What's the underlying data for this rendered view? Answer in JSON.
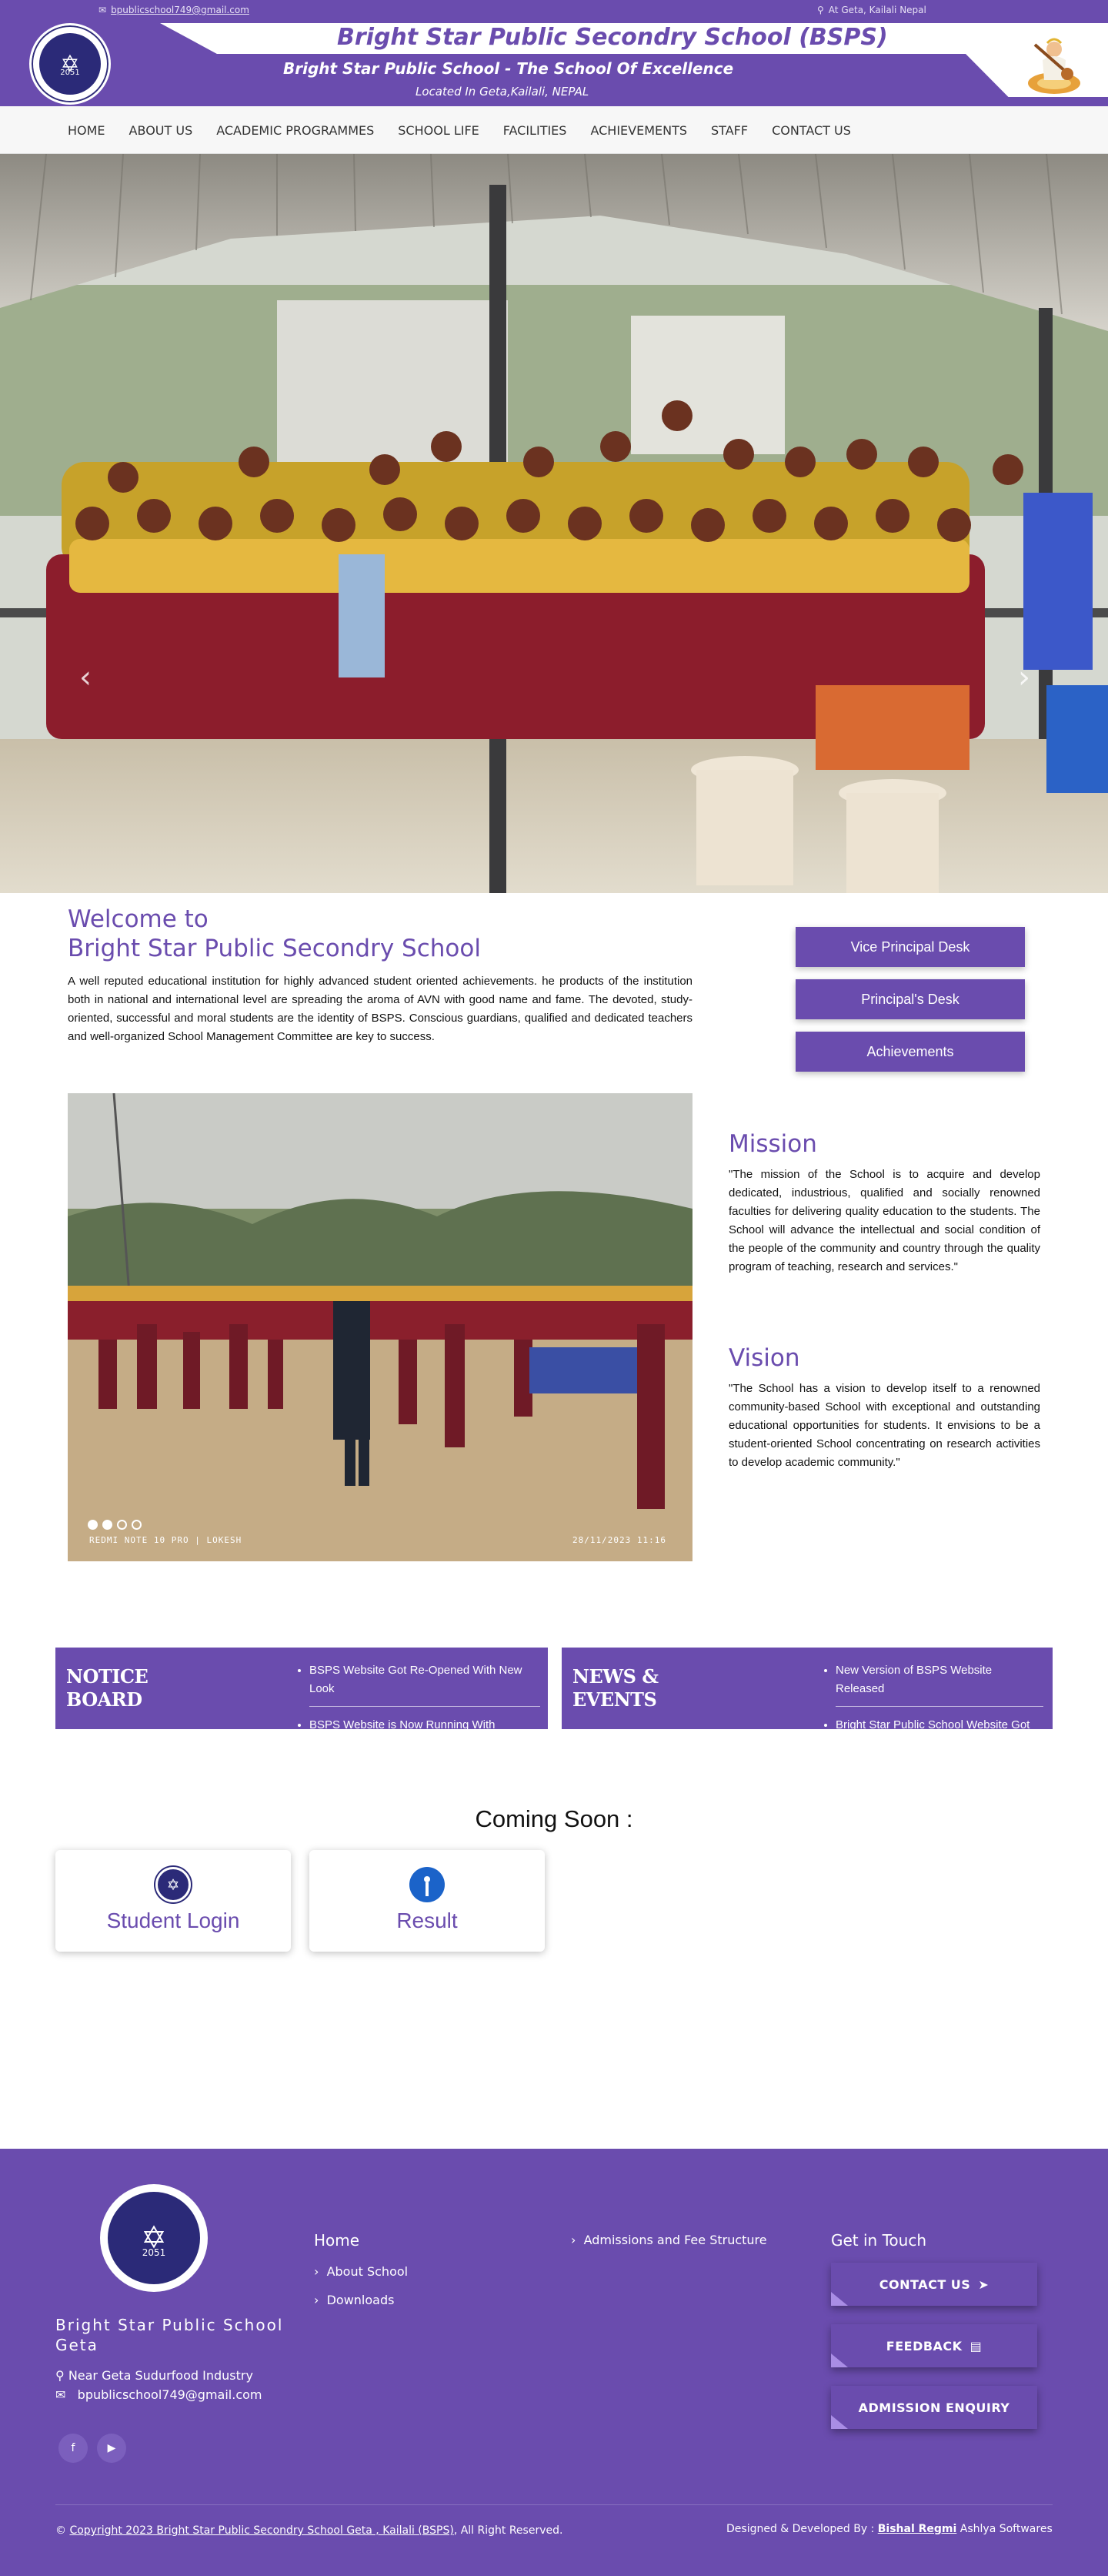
{
  "topbar": {
    "email": "bpublicschool749@gmail.com",
    "location": "At Geta, Kailali Nepal"
  },
  "header": {
    "title": "Bright Star Public Secondry School (BSPS)",
    "subtitle": "Bright Star Public School - The School Of Excellence",
    "located": "Located In Geta,Kailali, NEPAL",
    "logo_year": "2051"
  },
  "nav": {
    "items": [
      "HOME",
      "ABOUT US",
      "ACADEMIC PROGRAMMES",
      "SCHOOL LIFE",
      "FACILITIES",
      "ACHIEVEMENTS",
      "STAFF",
      "CONTACT US"
    ]
  },
  "welcome": {
    "line1": "Welcome to",
    "line2": "Bright Star Public Secondry School",
    "text": "A well reputed educational institution for highly advanced student oriented achievements. he products of the institution both in national and international level are spreading the aroma of AVN with good name and fame. The devoted, study-oriented, successful and moral students are the identity of BSPS. Conscious guardians, qualified and dedicated teachers and well-organized School Management Committee are key to success."
  },
  "desks": [
    "Vice Principal Desk",
    "Principal's Desk",
    "Achievements"
  ],
  "photo2": {
    "watermark_left": "REDMI NOTE 10 PRO | LOKESH",
    "watermark_right": "28/11/2023  11:16"
  },
  "mission": {
    "title": "Mission",
    "text": "\"The mission of the School is to acquire and develop dedicated, industrious, qualified and socially renowned faculties for delivering quality education to the students. The School will advance the intellectual and social condition of the people of the community and country through the quality program of teaching, research and services.\""
  },
  "vision": {
    "title": "Vision",
    "text": "\"The School has a vision to develop itself to a renowned community-based School with exceptional and outstanding educational opportunities for students. It envisions to be a student-oriented School concentrating on research activities to develop academic community.\""
  },
  "notice": {
    "label_line1": "NOTICE",
    "label_line2": "BOARD",
    "items": [
      "BSPS Website Got Re-Opened With New Look",
      "BSPS Website is Now Running With"
    ]
  },
  "news": {
    "label_line1": "NEWS &",
    "label_line2": "EVENTS",
    "items": [
      "New Version of BSPS Website Released",
      "Bright Star Public School Website Got"
    ]
  },
  "coming_soon": {
    "heading": "Coming Soon :",
    "cards": [
      "Student Login",
      "Result"
    ]
  },
  "footer": {
    "school_name": "Bright Star Public School Geta",
    "address": "Near Geta Sudurfood Industry",
    "email": "bpublicschool749@gmail.com",
    "col1_title": "Home",
    "col1_links": [
      "About School",
      "Downloads"
    ],
    "col2_links": [
      "Admissions and Fee Structure"
    ],
    "col3_title": "Get in Touch",
    "buttons": [
      "CONTACT US",
      "FEEDBACK",
      "ADMISSION ENQUIRY"
    ],
    "copyright_prefix": "© ",
    "copyright_link": "Copyright 2023 Bright Star Public Secondry School Geta , Kailali (BSPS)",
    "copyright_suffix": ", All Right Reserved.",
    "dev_prefix": "Designed & Developed By : ",
    "dev_name": "Bishal Regmi",
    "dev_suffix": " Ashlya Softwares"
  },
  "colors": {
    "brand": "#6a4cae",
    "logo_navy": "#2b2a78"
  }
}
